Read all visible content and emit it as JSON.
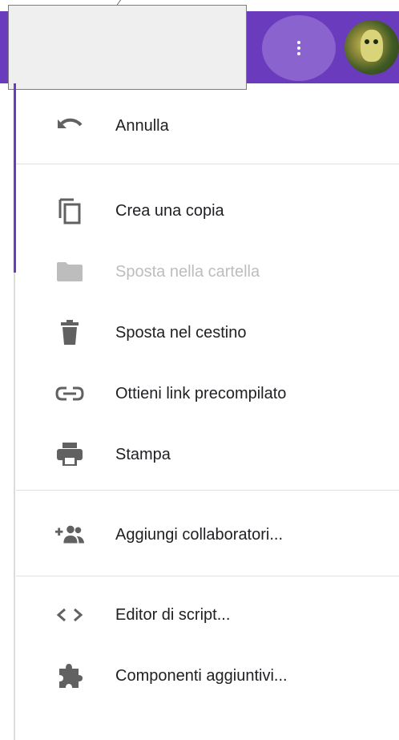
{
  "header": {
    "accent_color": "#6a3bbd",
    "more_button_icon": "more-vert-icon",
    "avatar_icon": "avatar"
  },
  "menu": {
    "groups": [
      {
        "items": [
          {
            "label": "Annulla",
            "icon": "undo-icon",
            "disabled": false
          }
        ]
      },
      {
        "items": [
          {
            "label": "Crea una copia",
            "icon": "copy-icon",
            "disabled": false
          },
          {
            "label": "Sposta nella cartella",
            "icon": "folder-icon",
            "disabled": true
          },
          {
            "label": "Sposta nel cestino",
            "icon": "trash-icon",
            "disabled": false
          },
          {
            "label": "Ottieni link precompilato",
            "icon": "link-icon",
            "disabled": false
          },
          {
            "label": "Stampa",
            "icon": "print-icon",
            "disabled": false
          }
        ]
      },
      {
        "items": [
          {
            "label": "Aggiungi collaboratori...",
            "icon": "add-people-icon",
            "disabled": false
          }
        ]
      },
      {
        "items": [
          {
            "label": "Editor di script...",
            "icon": "code-icon",
            "disabled": false
          },
          {
            "label": "Componenti aggiuntivi...",
            "icon": "puzzle-icon",
            "disabled": false
          }
        ]
      }
    ]
  }
}
